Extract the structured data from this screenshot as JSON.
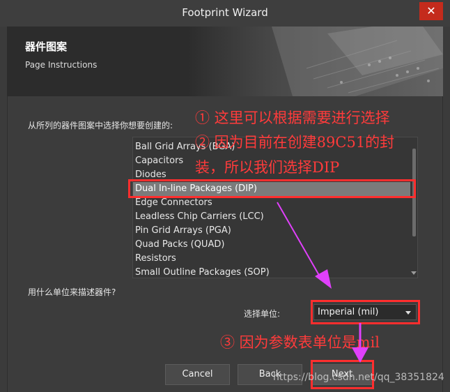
{
  "window": {
    "title": "Footprint Wizard",
    "close_glyph": "✕"
  },
  "header": {
    "title": "器件图案",
    "subtitle": "Page Instructions"
  },
  "instruction": "从所列的器件图案中选择你想要创建的:",
  "list": {
    "items": [
      "Ball Grid Arrays (BGA)",
      "Capacitors",
      "Diodes",
      "Dual In-line Packages (DIP)",
      "Edge Connectors",
      "Leadless Chip Carriers (LCC)",
      "Pin Grid Arrays (PGA)",
      "Quad Packs (QUAD)",
      "Resistors",
      "Small Outline Packages (SOP)"
    ],
    "selected": "Dual In-line Packages (DIP)"
  },
  "units": {
    "question": "用什么单位来描述器件?",
    "label": "选择单位:",
    "selected": "Imperial (mil)"
  },
  "buttons": {
    "cancel": "Cancel",
    "back": "Back",
    "next": "Next"
  },
  "annotations": {
    "a1": "① 这里可以根据需要进行选择",
    "a2_line1": "② 因为目前在创建89C51的封",
    "a2_line2": "装，所以我们选择DIP",
    "a3": "③ 因为参数表单位是mil"
  },
  "watermark": "https://blog.csdn.net/qq_38351824",
  "colors": {
    "annotation": "#ff2e2e",
    "arrow": "#e040fb",
    "selection": "#7b7b7b",
    "close": "#c42b1c"
  }
}
